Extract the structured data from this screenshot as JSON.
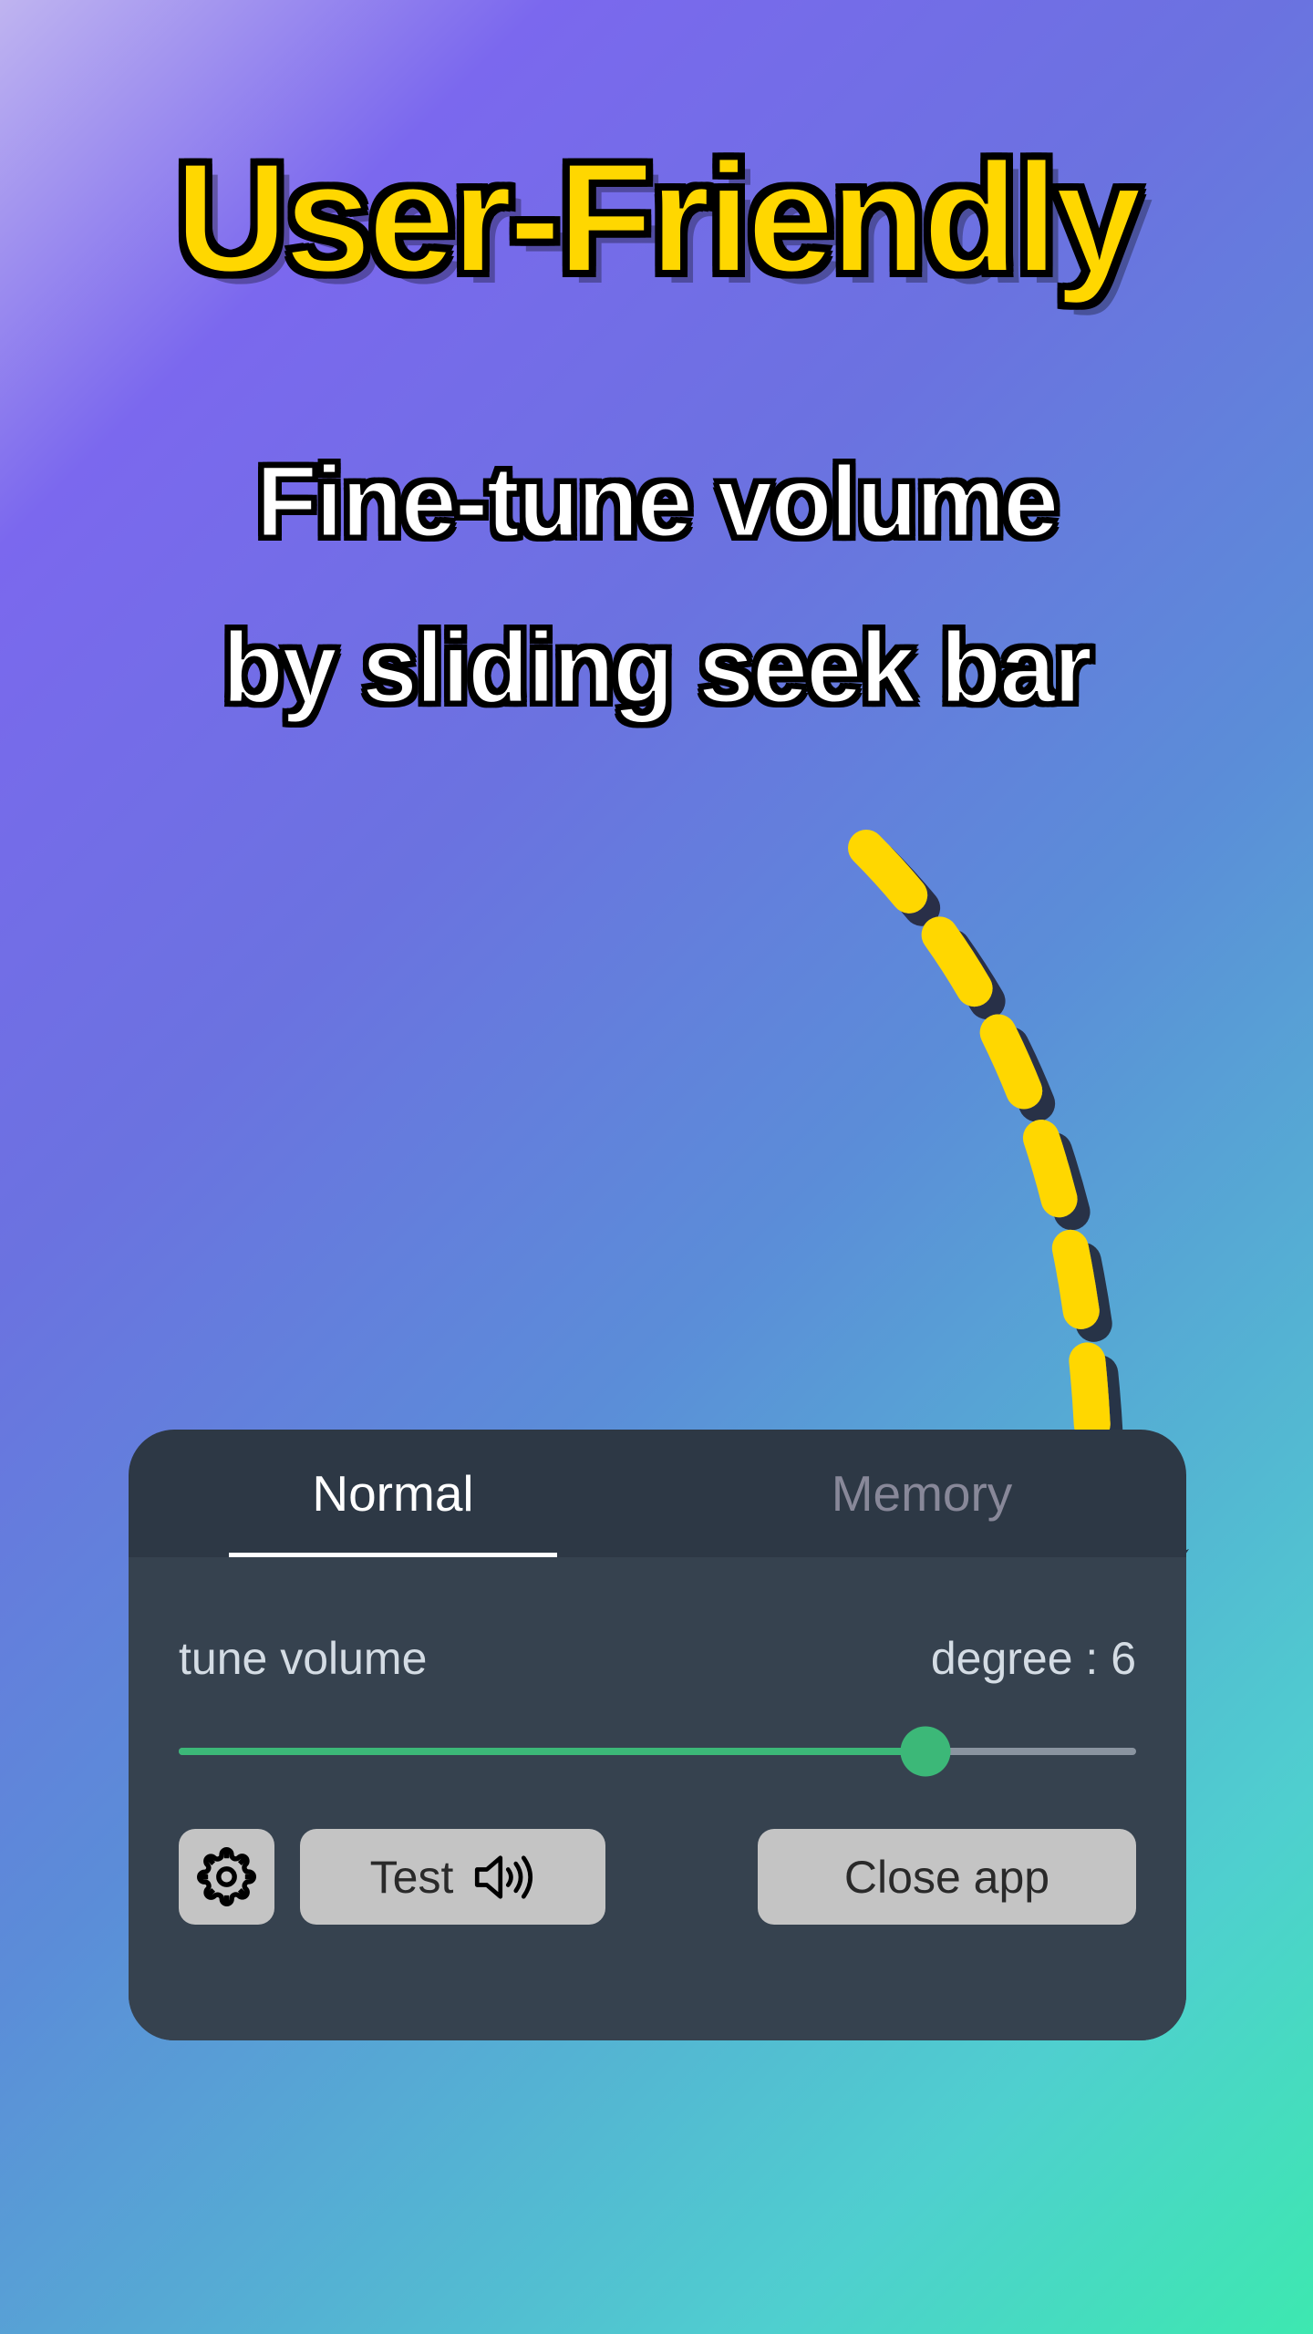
{
  "title": "User-Friendly",
  "subtitle_line1": "Fine-tune volume",
  "subtitle_line2": "by sliding seek bar",
  "panel": {
    "tabs": {
      "normal": "Normal",
      "memory": "Memory"
    },
    "slider": {
      "label": "tune volume",
      "degree_label": "degree : 6",
      "value": 6,
      "max": 8,
      "fill_percent": 78
    },
    "buttons": {
      "test": "Test",
      "close": "Close app"
    }
  }
}
